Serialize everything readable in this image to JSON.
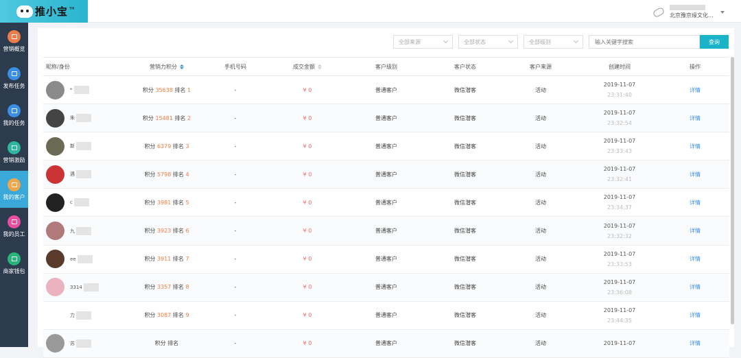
{
  "header": {
    "brand": "推小宝",
    "tm": "TM",
    "company": "北京豫京缘文化..."
  },
  "sidebar": [
    {
      "label": "营销概览",
      "color": "#ef7b4a",
      "icon": "chart-icon"
    },
    {
      "label": "发布任务",
      "color": "#3a8ee6",
      "icon": "task-icon"
    },
    {
      "label": "我的任务",
      "color": "#3a8ee6",
      "icon": "mytask-icon"
    },
    {
      "label": "营销激励",
      "color": "#2fb6a0",
      "icon": "reward-icon"
    },
    {
      "label": "我的客户",
      "color": "#f0a64a",
      "icon": "customer-icon"
    },
    {
      "label": "我的员工",
      "color": "#e84fa0",
      "icon": "employee-icon"
    },
    {
      "label": "商家钱包",
      "color": "#27b57a",
      "icon": "wallet-icon"
    }
  ],
  "filters": {
    "source": "全部来源",
    "status": "全部状态",
    "level": "全部级别",
    "search_placeholder": "输入关键字搜索",
    "query": "查询"
  },
  "columns": [
    "昵称/身份",
    "营销力积分",
    "手机号码",
    "成交金额",
    "客户级别",
    "客户状态",
    "客户来源",
    "创建时间",
    "操作"
  ],
  "rows": [
    {
      "name": "*",
      "score_label": "积分",
      "score": "35638",
      "rank_label": "排名",
      "rank": "1",
      "phone": "-",
      "amount": "¥ 0",
      "level": "普通客户",
      "status": "微信潜客",
      "source": "活动",
      "date": "2019-11-07",
      "time": "23:31:40",
      "action": "详情",
      "avatar": "#8a8a8a"
    },
    {
      "name": "朱",
      "score_label": "积分",
      "score": "15481",
      "rank_label": "排名",
      "rank": "2",
      "phone": "-",
      "amount": "¥ 0",
      "level": "普通客户",
      "status": "微信潜客",
      "source": "活动",
      "date": "2019-11-07",
      "time": "23:32:54",
      "action": "详情",
      "avatar": "#444"
    },
    {
      "name": "新",
      "score_label": "积分",
      "score": "6379",
      "rank_label": "排名",
      "rank": "3",
      "phone": "-",
      "amount": "¥ 0",
      "level": "普通客户",
      "status": "微信潜客",
      "source": "活动",
      "date": "2019-11-07",
      "time": "23:33:43",
      "action": "详情",
      "avatar": "#6b6b55"
    },
    {
      "name": "遇",
      "score_label": "积分",
      "score": "5798",
      "rank_label": "排名",
      "rank": "4",
      "phone": "-",
      "amount": "¥ 0",
      "level": "普通客户",
      "status": "微信潜客",
      "source": "活动",
      "date": "2019-11-07",
      "time": "23:32:41",
      "action": "详情",
      "avatar": "#c33"
    },
    {
      "name": "c",
      "score_label": "积分",
      "score": "3981",
      "rank_label": "排名",
      "rank": "5",
      "phone": "-",
      "amount": "¥ 0",
      "level": "普通客户",
      "status": "微信潜客",
      "source": "活动",
      "date": "2019-11-07",
      "time": "23:34:37",
      "action": "详情",
      "avatar": "#222"
    },
    {
      "name": "九",
      "score_label": "积分",
      "score": "3923",
      "rank_label": "排名",
      "rank": "6",
      "phone": "-",
      "amount": "¥ 0",
      "level": "普通客户",
      "status": "微信潜客",
      "source": "活动",
      "date": "2019-11-07",
      "time": "23:32:32",
      "action": "详情",
      "avatar": "#b07a7a"
    },
    {
      "name": "ee",
      "score_label": "积分",
      "score": "3911",
      "rank_label": "排名",
      "rank": "7",
      "phone": "-",
      "amount": "¥ 0",
      "level": "普通客户",
      "status": "微信潜客",
      "source": "活动",
      "date": "2019-11-07",
      "time": "23:33:53",
      "action": "详情",
      "avatar": "#5a3a2a"
    },
    {
      "name": "3314",
      "score_label": "积分",
      "score": "3357",
      "rank_label": "排名",
      "rank": "8",
      "phone": "-",
      "amount": "¥ 0",
      "level": "普通客户",
      "status": "微信潜客",
      "source": "活动",
      "date": "2019-11-07",
      "time": "23:36:08",
      "action": "详情",
      "avatar": "#e9b4c0"
    },
    {
      "name": "力",
      "score_label": "积分",
      "score": "3087",
      "rank_label": "排名",
      "rank": "9",
      "phone": "-",
      "amount": "¥ 0",
      "level": "普通客户",
      "status": "微信潜客",
      "source": "活动",
      "date": "2019-11-07",
      "time": "23:44:35",
      "action": "详情",
      "avatar": "#fff"
    },
    {
      "name": "苏",
      "score_label": "积分",
      "score": "",
      "rank_label": "排名",
      "rank": "",
      "phone": "-",
      "amount": "¥ 0",
      "level": "普通客户",
      "status": "微信潜客",
      "source": "活动",
      "date": "2019-11-07",
      "time": "",
      "action": "详情",
      "avatar": "#999"
    }
  ]
}
